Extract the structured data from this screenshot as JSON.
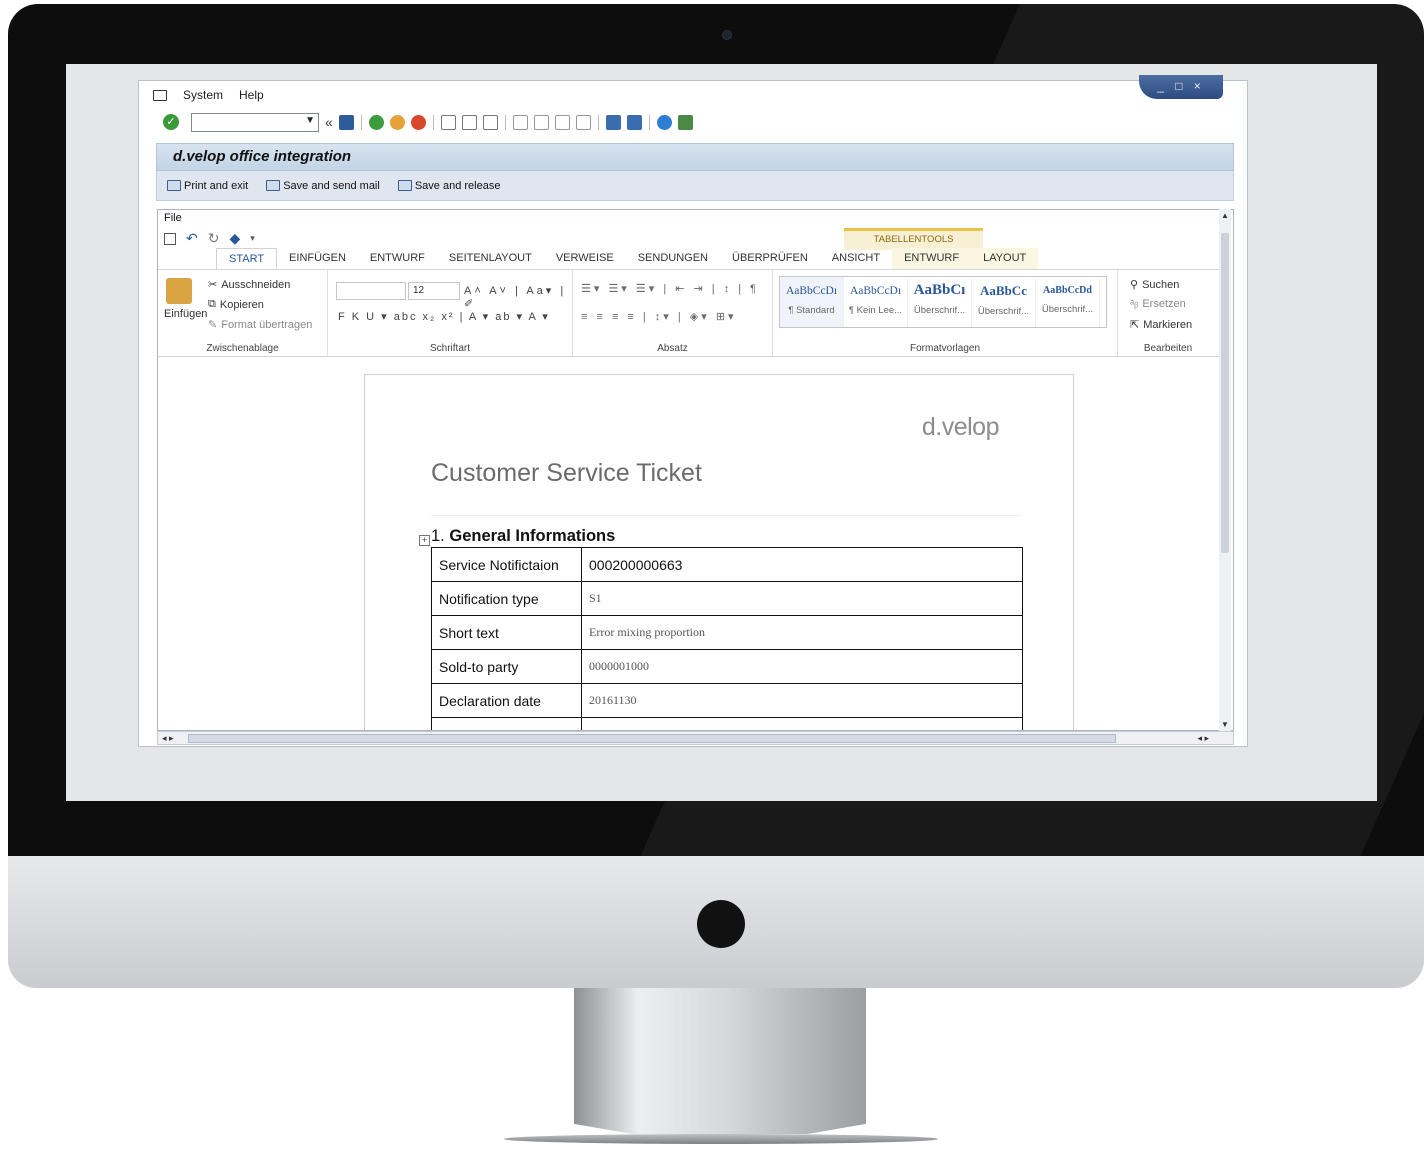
{
  "sap": {
    "menu": [
      "System",
      "Help"
    ],
    "window_controls": "_ □ ×",
    "title": "d.velop office integration",
    "app_toolbar": [
      {
        "label": "Print and exit",
        "icon": "printer-icon"
      },
      {
        "label": "Save and send mail",
        "icon": "mail-icon"
      },
      {
        "label": "Save and release",
        "icon": "flag-icon"
      }
    ]
  },
  "word": {
    "file_label": "File",
    "tab_group_label": "TABELLENTOOLS",
    "tabs": [
      "START",
      "EINFÜGEN",
      "ENTWURF",
      "SEITENLAYOUT",
      "VERWEISE",
      "SENDUNGEN",
      "ÜBERPRÜFEN",
      "ANSICHT",
      "ENTWURF",
      "LAYOUT"
    ],
    "ribbon": {
      "clipboard": {
        "paste": "Einfügen",
        "cut": "Ausschneiden",
        "copy": "Kopieren",
        "format_painter": "Format übertragen",
        "label": "Zwischenablage"
      },
      "font": {
        "size": "12",
        "label": "Schriftart"
      },
      "paragraph": {
        "label": "Absatz"
      },
      "styles": {
        "items": [
          {
            "sample": "AaBbCcDı",
            "name": "¶ Standard"
          },
          {
            "sample": "AaBbCcDı",
            "name": "¶ Kein Lee..."
          },
          {
            "sample": "AaBbCı",
            "name": "Überschrif..."
          },
          {
            "sample": "AaBbCc",
            "name": "Überschrif..."
          },
          {
            "sample": "AaBbCcDd",
            "name": "Überschrif..."
          }
        ],
        "label": "Formatvorlagen"
      },
      "editing": {
        "find": "Suchen",
        "replace": "Ersetzen",
        "select": "Markieren",
        "label": "Bearbeiten"
      }
    }
  },
  "document": {
    "logo": "d.velop",
    "title": "Customer Service Ticket",
    "section_heading_number": "1.",
    "section_heading": "General Informations",
    "rows": [
      {
        "key": "Service Notifictaion",
        "value": "000200000663"
      },
      {
        "key": "Notification type",
        "value": "S1"
      },
      {
        "key": "Short text",
        "value": "Error mixing  proportion"
      },
      {
        "key": "Sold-to party",
        "value": "0000001000"
      },
      {
        "key": "Declaration date",
        "value": "20161130"
      }
    ]
  }
}
